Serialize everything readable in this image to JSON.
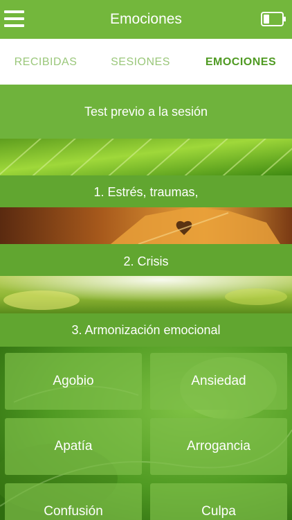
{
  "header": {
    "title": "Emociones",
    "menu_icon": "hamburger-menu-icon",
    "battery_icon": "battery-icon",
    "bar_color": "#73b73c"
  },
  "tabs": [
    {
      "label": "RECIBIDAS",
      "active": false
    },
    {
      "label": "SESIONES",
      "active": false
    },
    {
      "label": "EMOCIONES",
      "active": true
    }
  ],
  "sections": {
    "test": "Test previo a la sesión",
    "items": [
      {
        "label": "1. Estrés, traumas,",
        "image": "green-leaf"
      },
      {
        "label": "2. Crisis",
        "image": "autumn-leaf-heart"
      },
      {
        "label": "3. Armonización emocional",
        "image": "sunlit-grass"
      }
    ]
  },
  "emotions": [
    "Agobio",
    "Ansiedad",
    "Apatía",
    "Arrogancia",
    "Confusión",
    "Culpa"
  ],
  "colors": {
    "accent": "#73b73c",
    "tab_active": "#4f9a22",
    "tab_inactive": "#9ac77a"
  }
}
